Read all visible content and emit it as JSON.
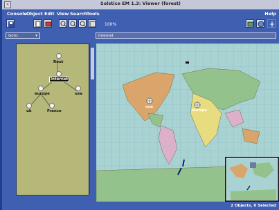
{
  "window": {
    "title": "Solstice EM 1.3: Viewer (forest)",
    "close_glyph": "×"
  },
  "menu": {
    "items": [
      "Console",
      "Object",
      "Edit",
      "View",
      "Search",
      "Tools"
    ],
    "help": "Help"
  },
  "toolbar": {
    "zoom_level": "100%",
    "buttons": [
      "save-icon",
      "print-icon",
      "document-icon",
      "zoom-in-icon",
      "zoom-out-icon",
      "zoom-fit-icon",
      "zoom-reset-icon",
      "map-icon",
      "globe-icon",
      "tree-icon"
    ]
  },
  "navigation": {
    "goto_label": "Goto:",
    "address_value": "Internet"
  },
  "tree": {
    "root": "Root",
    "internet": "Internet",
    "europe": "europe",
    "usa": "usa",
    "uk": "uk",
    "france": "France"
  },
  "map": {
    "labels": {
      "usa": "usa",
      "europe": "europe"
    },
    "colors": {
      "ocean": "#a9d3d2",
      "land_a": "#d9a56a",
      "land_b": "#94c28d",
      "land_c": "#ddb0c9",
      "land_d": "#e8dc80",
      "grid": "#86b5c0"
    }
  },
  "status": {
    "text": "2 Objects, 0 Selected"
  }
}
